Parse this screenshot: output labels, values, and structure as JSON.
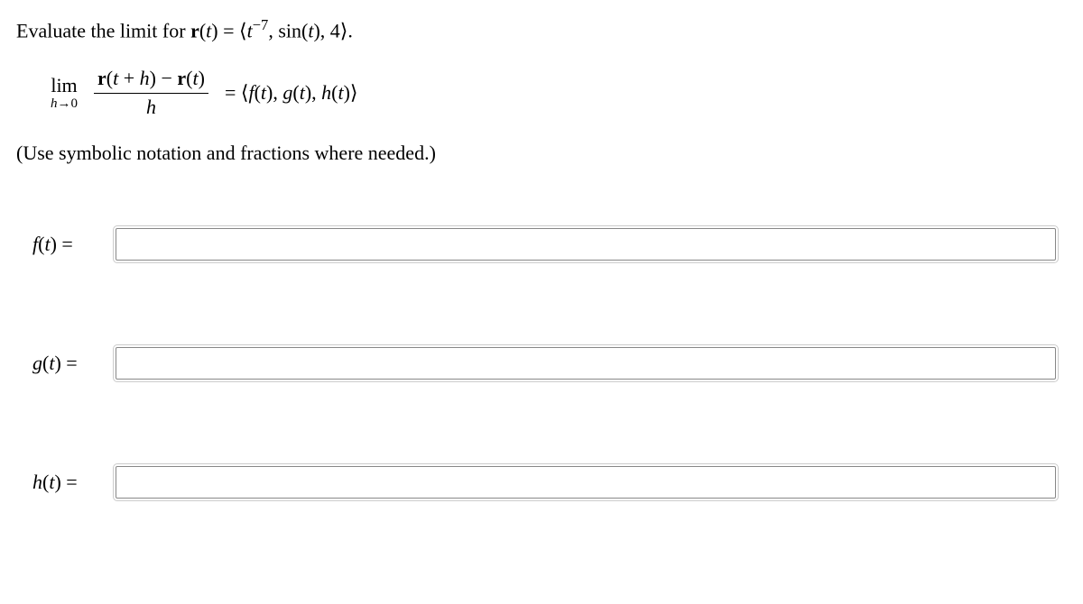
{
  "problem": {
    "intro_prefix": "Evaluate the limit for ",
    "r_of_t": "r",
    "r_arg": "(t)",
    "eq_sign": " = ",
    "vector_open": "⟨",
    "comp1_base": "t",
    "comp1_exp": "−7",
    "sep": ", ",
    "comp2": "sin(",
    "comp2_arg": "t",
    "comp2_close": ")",
    "comp3": "4",
    "vector_close": "⟩",
    "period": "."
  },
  "limit": {
    "lim_word": "lim",
    "lim_sub_h": "h",
    "lim_sub_arrow": "→",
    "lim_sub_zero": "0",
    "num_r": "r",
    "num_lpar": "(",
    "num_t": "t",
    "num_plus": " + ",
    "num_h": "h",
    "num_rpar": ")",
    "num_minus": " − ",
    "num_r2": "r",
    "num_t2": "(t)",
    "den_h": "h",
    "eq": " = ",
    "rhs_open": "⟨",
    "rhs_f": "f",
    "rhs_ft": "(t)",
    "rhs_sep": ", ",
    "rhs_g": "g",
    "rhs_gt": "(t)",
    "rhs_h": "h",
    "rhs_ht": "(t)",
    "rhs_close": "⟩"
  },
  "hint": "(Use symbolic notation and fractions where needed.)",
  "answers": {
    "f_label_fn": "f",
    "f_label_arg": "(t) =",
    "g_label_fn": "g",
    "g_label_arg": "(t) =",
    "h_label_fn": "h",
    "h_label_arg": "(t) =",
    "f_value": "",
    "g_value": "",
    "h_value": "",
    "f_placeholder": "",
    "g_placeholder": "",
    "h_placeholder": ""
  }
}
